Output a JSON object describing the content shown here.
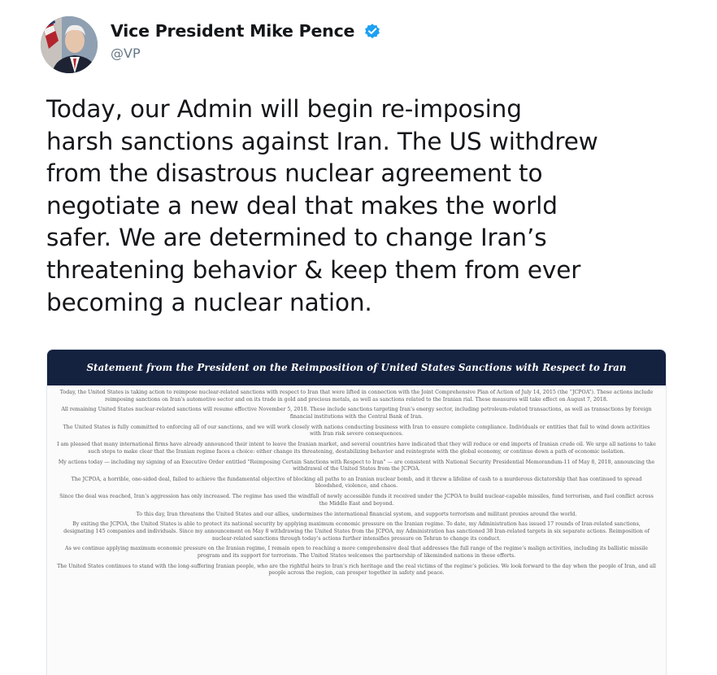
{
  "tweet": {
    "author": {
      "display_name": "Vice President Mike Pence",
      "handle": "@VP",
      "verified": true
    },
    "text_lines": [
      "Today, our Admin will begin re-imposing",
      "harsh sanctions against Iran. The US withdrew",
      "from the disastrous nuclear agreement to",
      "negotiate a new deal that makes the world",
      "safer. We are determined to change Iran’s",
      "threatening behavior & keep them from ever",
      "becoming a nuclear nation."
    ],
    "attached_image": {
      "title": "Statement from the President on the Reimposition of United States Sanctions with Respect to Iran",
      "paragraphs": [
        "Today, the United States is taking action to reimpose nuclear-related sanctions with respect to Iran that were lifted in connection with the Joint Comprehensive Plan of Action of July 14, 2015 (the “JCPOA”). These actions include reimposing sanctions on Iran’s automotive sector and on its trade in gold and precious metals, as well as sanctions related to the Iranian rial. These measures will take effect on August 7, 2018.",
        "All remaining United States nuclear-related sanctions will resume effective November 5, 2018. These include sanctions targeting Iran’s energy sector, including petroleum-related transactions, as well as transactions by foreign financial institutions with the Central Bank of Iran.",
        "The United States is fully committed to enforcing all of our sanctions, and we will work closely with nations conducting business with Iran to ensure complete compliance. Individuals or entities that fail to wind down activities with Iran risk severe consequences.",
        "I am pleased that many international firms have already announced their intent to leave the Iranian market, and several countries have indicated that they will reduce or end imports of Iranian crude oil. We urge all nations to take such steps to make clear that the Iranian regime faces a choice: either change its threatening, destabilizing behavior and reintegrate with the global economy, or continue down a path of economic isolation.",
        "My actions today — including my signing of an Executive Order entitled “Reimposing Certain Sanctions with Respect to Iran” — are consistent with National Security Presidential Memorandum-11 of May 8, 2018, announcing the withdrawal of the United States from the JCPOA.",
        "The JCPOA, a horrible, one-sided deal, failed to achieve the fundamental objective of blocking all paths to an Iranian nuclear bomb, and it threw a lifeline of cash to a murderous dictatorship that has continued to spread bloodshed, violence, and chaos.",
        "Since the deal was reached, Iran’s aggression has only increased. The regime has used the windfall of newly accessible funds it received under the JCPOA to build nuclear-capable missiles, fund terrorism, and fuel conflict across the Middle East and beyond.",
        "To this day, Iran threatens the United States and our allies, undermines the international financial system, and supports terrorism and militant proxies around the world.",
        "By exiting the JCPOA, the United States is able to protect its national security by applying maximum economic pressure on the Iranian regime. To date, my Administration has issued 17 rounds of Iran-related sanctions, designating 145 companies and individuals. Since my announcement on May 8 withdrawing the United States from the JCPOA, my Administration has sanctioned 38 Iran-related targets in six separate actions. Reimposition of nuclear-related sanctions through today’s actions further intensifies pressure on Tehran to change its conduct.",
        "As we continue applying maximum economic pressure on the Iranian regime, I remain open to reaching a more comprehensive deal that addresses the full range of the regime’s malign activities, including its ballistic missile program and its support for terrorism. The United States welcomes the partnership of likeminded nations in these efforts.",
        "The United States continues to stand with the long-suffering Iranian people, who are the rightful heirs to Iran’s rich heritage and the real victims of the regime’s policies. We look forward to the day when the people of Iran, and all people across the region, can prosper together in safety and peace."
      ]
    }
  },
  "colors": {
    "text_primary": "#14171a",
    "text_secondary": "#657786",
    "verified_blue": "#1da1f2",
    "banner_navy": "#14213f"
  },
  "icons": {
    "verified": "verified-badge-icon",
    "avatar": "profile-photo"
  }
}
